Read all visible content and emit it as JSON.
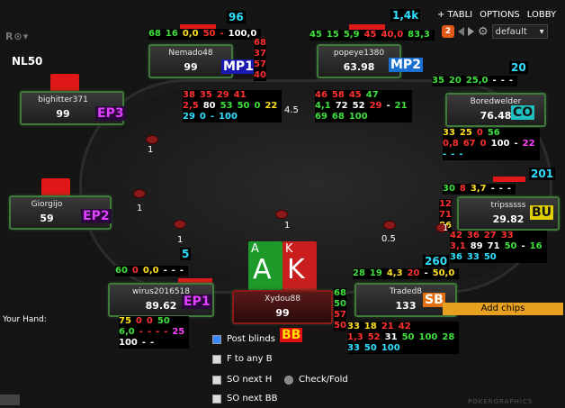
{
  "topbar": {
    "tabs": "+ TABLI",
    "options": "OPTIONS",
    "lobby": "LOBBY",
    "badge": "2",
    "dropdown": "default"
  },
  "logo": "R",
  "limit": "NL50",
  "players": {
    "nemado": {
      "name": "Nemado48",
      "stack": "99",
      "pos": "MP1",
      "hands": "96",
      "hud_top": [
        "68",
        "16",
        "0,0",
        "50",
        "-",
        "100,0"
      ],
      "hud_side": [
        "68",
        "37",
        "57",
        "40"
      ],
      "hud_lines": [
        [
          "38",
          "35",
          "29",
          "41"
        ],
        [
          "2,5",
          "80",
          "53",
          "50",
          "0",
          "22"
        ],
        [
          "29",
          "0",
          "-",
          "100"
        ]
      ]
    },
    "popeye": {
      "name": "popeye1380",
      "stack": "63.98",
      "pos": "MP2",
      "hands": "1,4k",
      "hud_top": [
        "45",
        "15",
        "5,9",
        "45",
        "40,0",
        "83,3"
      ],
      "hud_lines": [
        [
          "46",
          "58",
          "45",
          "47"
        ],
        [
          "4,1",
          "72",
          "52",
          "29",
          "-",
          "21"
        ],
        [
          "69",
          "68",
          "100"
        ]
      ]
    },
    "bighitter": {
      "name": "bighitter371",
      "stack": "99",
      "pos": "EP3",
      "bet": "4.5"
    },
    "boredwelder": {
      "name": "Boredwelder",
      "stack": "76.48",
      "pos": "CO",
      "hands": "20",
      "hud_top": [
        "35",
        "20",
        "25,0",
        "-",
        "-",
        "-"
      ],
      "hud_lines": [
        [
          "33",
          "25",
          "0",
          "56"
        ],
        [
          "0,8",
          "67",
          "0",
          "100",
          "-",
          "22"
        ],
        [
          "-",
          "-",
          "-"
        ]
      ]
    },
    "tripssss": {
      "name": "tripsssss",
      "stack": "29.82",
      "pos": "BU",
      "hands": "201",
      "hud_top": [
        "30",
        "8",
        "3,7",
        "-",
        "-",
        "-"
      ],
      "hud_side": [
        "12",
        "71",
        "86"
      ],
      "hud_lines": [
        [
          "42",
          "36",
          "27",
          "33"
        ],
        [
          "3,1",
          "89",
          "71",
          "50",
          "-",
          "16"
        ],
        [
          "36",
          "33",
          "50"
        ]
      ]
    },
    "giorgijo": {
      "name": "Giorgijo",
      "stack": "59",
      "pos": "EP2"
    },
    "wirus": {
      "name": "wirus2016518",
      "stack": "89.62",
      "pos": "EP1",
      "hands": "5",
      "hud_top": [
        "60",
        "0",
        "0,0",
        "-",
        "-",
        "-"
      ],
      "hud_lines": [
        [
          "75",
          "0",
          "0",
          "50"
        ],
        [
          "6,0",
          "-",
          "-",
          "-",
          "-",
          "25"
        ],
        [
          "100",
          "-",
          "-"
        ]
      ]
    },
    "hero": {
      "name": "Xydou88",
      "stack": "99",
      "pos": "BB",
      "hud_side": [
        "68",
        "50",
        "57",
        "50"
      ]
    },
    "traded": {
      "name": "Traded8",
      "stack": "133",
      "pos": "SB",
      "hands": "260",
      "hud_top": [
        "28",
        "19",
        "4,3",
        "20",
        "-",
        "50,0"
      ],
      "hud_lines": [
        [
          "33",
          "18",
          "21",
          "42"
        ],
        [
          "1,3",
          "52",
          "31",
          "50",
          "100",
          "28"
        ],
        [
          "33",
          "50",
          "100"
        ]
      ]
    }
  },
  "bets": {
    "b1": "1",
    "b2": "1",
    "b3": "1",
    "b4": "1",
    "b5": "0.5",
    "b6": "1"
  },
  "hero_cards": [
    {
      "rank": "A",
      "color": "#1d9a2a"
    },
    {
      "rank": "K",
      "color": "#c81e1e"
    }
  ],
  "hand_label": "Your Hand:",
  "actions": {
    "post_blinds": "Post blinds",
    "fold_any": "F to any B",
    "so_next_h": "SO next H",
    "check_fold": "Check/Fold",
    "so_next_bb": "SO next BB"
  },
  "add_chips": "Add chips",
  "watermark": "POKERGRAPHICS",
  "colors": {
    "green": "#3ee03e",
    "red": "#ff3030",
    "cyan": "#30e0ff",
    "add_chips": "#e8a020"
  }
}
